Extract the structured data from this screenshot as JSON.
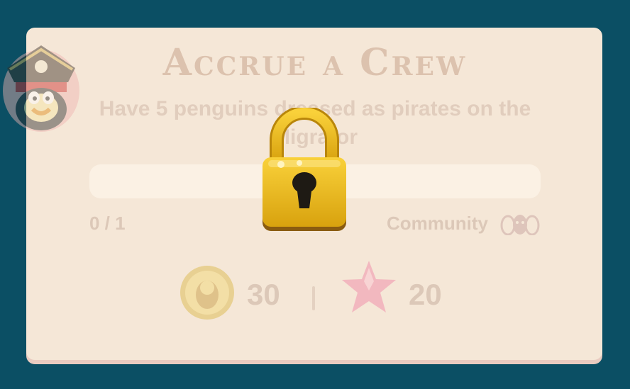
{
  "challenge": {
    "title": "Accrue a Crew",
    "description": "Have 5 penguins dressed as pirates on the Migrator",
    "progress": {
      "text": "0 / 1",
      "current": 0,
      "total": 1
    },
    "type_label": "Community",
    "rewards": {
      "coins": "30",
      "xp": "20"
    },
    "locked": true
  },
  "icons": {
    "avatar": "pirate-penguin-avatar-icon",
    "community": "community-icon",
    "coin": "coin-icon",
    "star": "star-icon",
    "lock": "lock-icon"
  },
  "colors": {
    "background": "#0b4f64",
    "card": "#f5e7d7",
    "lock_gold": "#e6b316"
  }
}
